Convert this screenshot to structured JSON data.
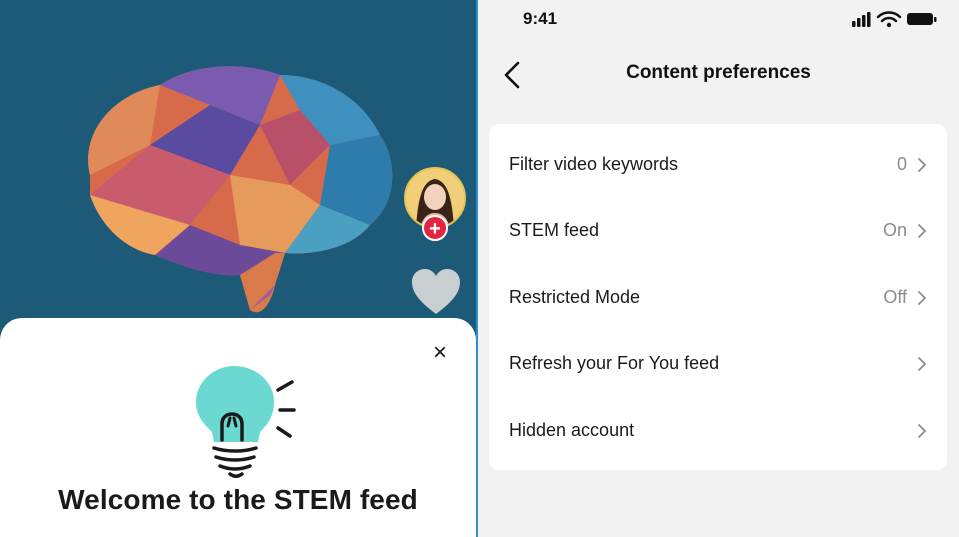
{
  "left": {
    "sheet": {
      "title": "Welcome to the STEM feed",
      "close_label": "×"
    },
    "follow_badge": "+",
    "colors": {
      "background": "#1c5a78",
      "bulb": "#6cd8d2",
      "follow_badge": "#e2263f"
    },
    "icons": [
      "brain-illustration",
      "creator-avatar",
      "follow-plus-icon",
      "heart-icon",
      "lightbulb-icon",
      "close-icon"
    ]
  },
  "right": {
    "status_bar": {
      "time": "9:41",
      "icons": [
        "signal-icon",
        "wifi-icon",
        "battery-icon"
      ]
    },
    "nav": {
      "title": "Content preferences",
      "back_icon": "chevron-left-icon"
    },
    "rows": [
      {
        "label": "Filter video keywords",
        "value": "0"
      },
      {
        "label": "STEM feed",
        "value": "On"
      },
      {
        "label": "Restricted Mode",
        "value": "Off"
      },
      {
        "label": "Refresh your For You feed",
        "value": ""
      },
      {
        "label": "Hidden account",
        "value": ""
      }
    ]
  }
}
